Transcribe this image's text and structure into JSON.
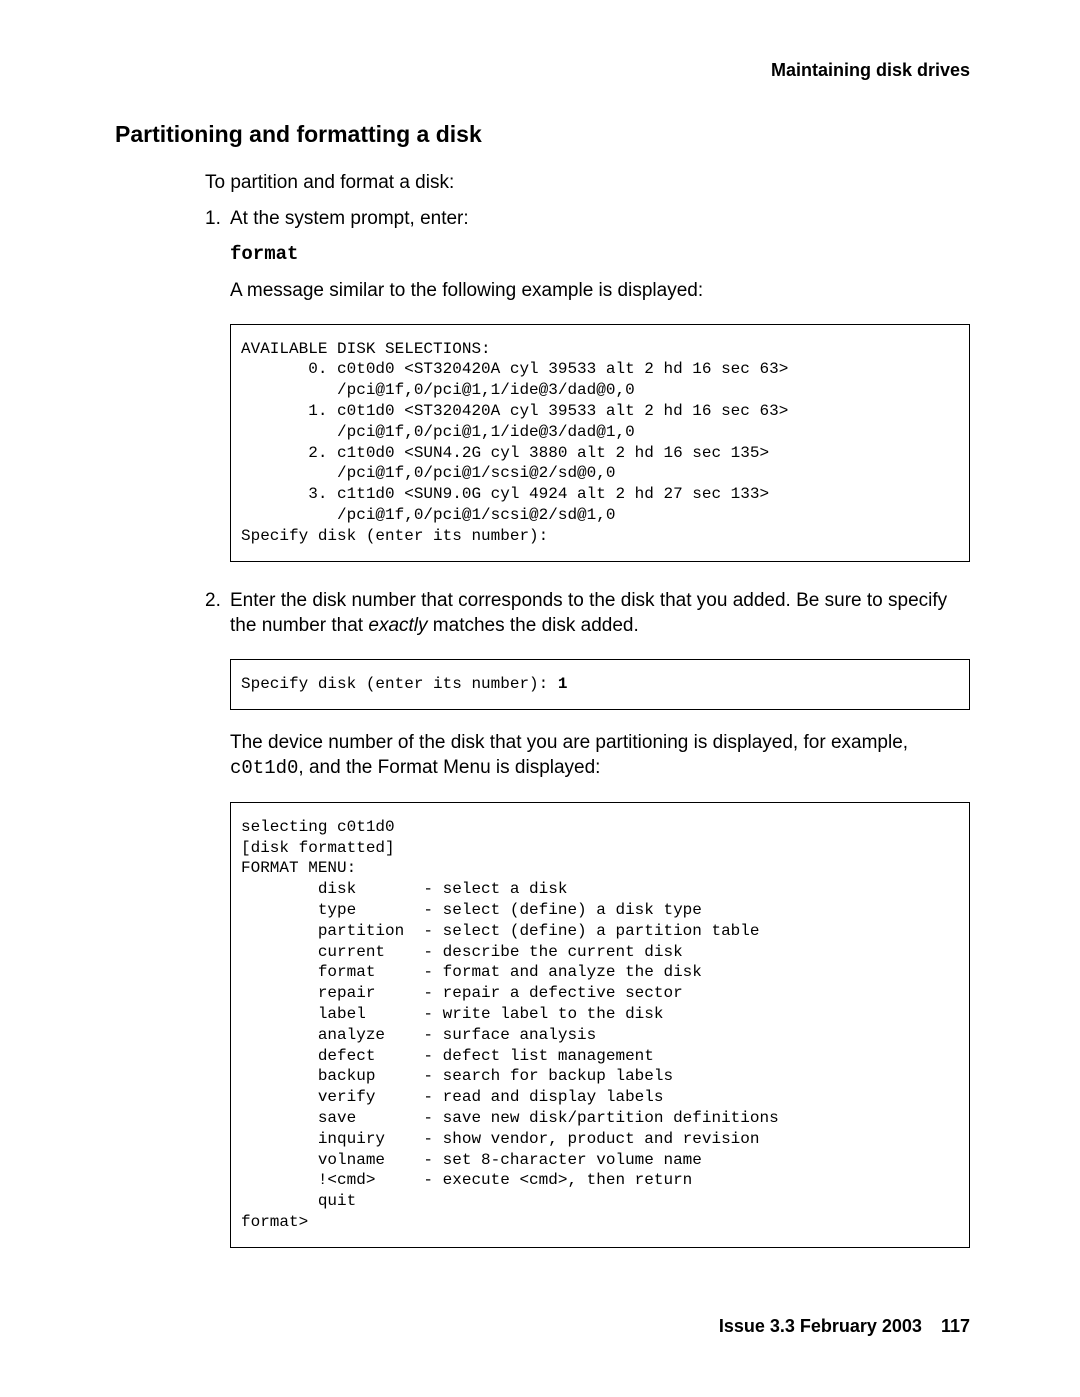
{
  "header": {
    "running": "Maintaining disk drives"
  },
  "section": {
    "heading": "Partitioning and formatting a disk",
    "intro": "To partition and format a disk:"
  },
  "steps": {
    "s1": {
      "num": "1.",
      "line1": "At the system prompt, enter:",
      "format_cmd": "format",
      "line2": "A message similar to the following example is displayed:"
    },
    "s2": {
      "num": "2.",
      "line1_a": "Enter the disk number that corresponds to the disk that you added. Be sure to specify the number that ",
      "line1_em": "exactly",
      "line1_b": " matches the disk added.",
      "after_a": "The device number of the disk that you are partitioning is displayed, for example, ",
      "after_code": "c0t1d0",
      "after_b": ", and the Format Menu is displayed:"
    }
  },
  "code1": "AVAILABLE DISK SELECTIONS:\n       0. c0t0d0 <ST320420A cyl 39533 alt 2 hd 16 sec 63>\n          /pci@1f,0/pci@1,1/ide@3/dad@0,0\n       1. c0t1d0 <ST320420A cyl 39533 alt 2 hd 16 sec 63>\n          /pci@1f,0/pci@1,1/ide@3/dad@1,0\n       2. c1t0d0 <SUN4.2G cyl 3880 alt 2 hd 16 sec 135>\n          /pci@1f,0/pci@1/scsi@2/sd@0,0\n       3. c1t1d0 <SUN9.0G cyl 4924 alt 2 hd 27 sec 133>\n          /pci@1f,0/pci@1/scsi@2/sd@1,0\nSpecify disk (enter its number):",
  "code2_prefix": "Specify disk (enter its number): ",
  "code2_bold": "1",
  "code3": "selecting c0t1d0\n[disk formatted]\nFORMAT MENU:\n        disk       - select a disk\n        type       - select (define) a disk type\n        partition  - select (define) a partition table\n        current    - describe the current disk\n        format     - format and analyze the disk\n        repair     - repair a defective sector\n        label      - write label to the disk\n        analyze    - surface analysis\n        defect     - defect list management\n        backup     - search for backup labels\n        verify     - read and display labels\n        save       - save new disk/partition definitions\n        inquiry    - show vendor, product and revision\n        volname    - set 8-character volume name\n        !<cmd>     - execute <cmd>, then return\n        quit\nformat>",
  "footer": {
    "issue": "Issue 3.3  February 2003",
    "page": "117"
  }
}
